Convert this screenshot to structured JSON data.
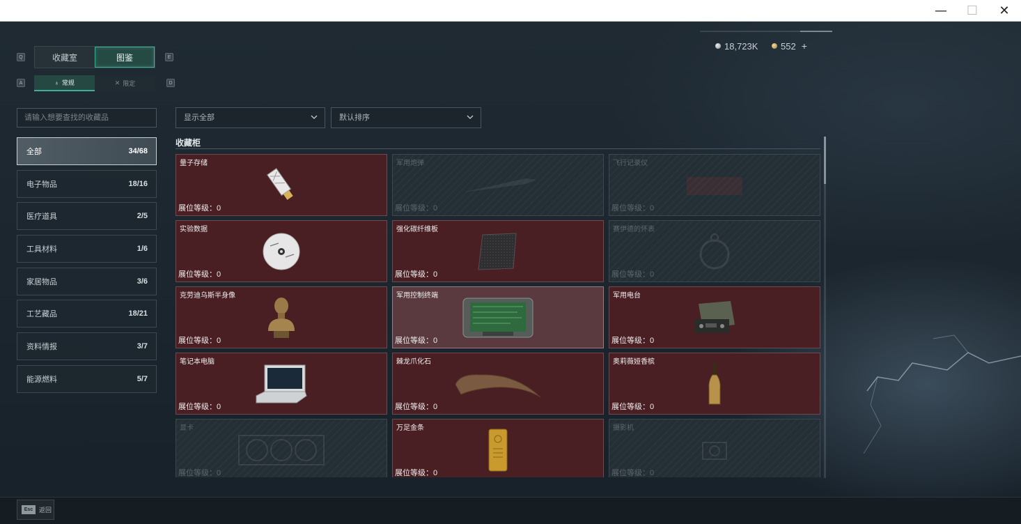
{
  "window": {
    "minimize_icon": "minimize-icon",
    "maximize_icon": "maximize-icon",
    "close_icon": "close-icon",
    "min_glyph": "—",
    "max_glyph": "☐",
    "close_glyph": "✕"
  },
  "currency": {
    "silver": "18,723K",
    "gold": "552",
    "plus": "+"
  },
  "tabs": {
    "left_key": "Q",
    "right_key": "E",
    "items": [
      {
        "label": "收藏室",
        "active": false
      },
      {
        "label": "图鉴",
        "active": true
      }
    ]
  },
  "subtabs": {
    "left_key": "A",
    "right_key": "D",
    "items": [
      {
        "label": "常规",
        "icon": "hourglass-icon",
        "glyph": "♁",
        "active": true
      },
      {
        "label": "限定",
        "icon": "crossed-swords-icon",
        "glyph": "✕",
        "active": false
      }
    ]
  },
  "search": {
    "placeholder": "请输入想要查找的收藏品"
  },
  "categories": [
    {
      "label": "全部",
      "count": "34/68",
      "active": true
    },
    {
      "label": "电子物品",
      "count": "18/16",
      "active": false
    },
    {
      "label": "医疗道具",
      "count": "2/5",
      "active": false
    },
    {
      "label": "工具材料",
      "count": "1/6",
      "active": false
    },
    {
      "label": "家居物品",
      "count": "3/6",
      "active": false
    },
    {
      "label": "工艺藏品",
      "count": "18/21",
      "active": false
    },
    {
      "label": "资料情报",
      "count": "3/7",
      "active": false
    },
    {
      "label": "能源燃料",
      "count": "5/7",
      "active": false
    }
  ],
  "filters": {
    "show": "显示全部",
    "sort": "默认排序"
  },
  "section": {
    "title": "收藏柜"
  },
  "cards": [
    {
      "name": "量子存储",
      "level": "展位等级：0",
      "state": "owned",
      "icon": "usb-drive-icon"
    },
    {
      "name": "军用炮弹",
      "level": "展位等级：0",
      "state": "locked",
      "icon": "artillery-shell-icon"
    },
    {
      "name": "飞行记录仪",
      "level": "展位等级：0",
      "state": "locked",
      "icon": "flight-recorder-icon"
    },
    {
      "name": "实验数据",
      "level": "展位等级：0",
      "state": "owned",
      "icon": "disc-icon"
    },
    {
      "name": "强化碳纤维板",
      "level": "展位等级：0",
      "state": "owned",
      "icon": "carbon-plate-icon"
    },
    {
      "name": "赛伊德的怀表",
      "level": "展位等级：0",
      "state": "locked",
      "icon": "pocket-watch-icon"
    },
    {
      "name": "克劳迪乌斯半身像",
      "level": "展位等级：0",
      "state": "owned",
      "icon": "bust-icon"
    },
    {
      "name": "军用控制终端",
      "level": "展位等级：0",
      "state": "highlight",
      "icon": "control-terminal-icon"
    },
    {
      "name": "军用电台",
      "level": "展位等级：0",
      "state": "owned",
      "icon": "radio-icon"
    },
    {
      "name": "笔记本电脑",
      "level": "展位等级：0",
      "state": "owned",
      "icon": "laptop-icon"
    },
    {
      "name": "棘龙爪化石",
      "level": "展位等级：0",
      "state": "owned",
      "icon": "claw-fossil-icon"
    },
    {
      "name": "奥莉薇娅香槟",
      "level": "展位等级：0",
      "state": "owned",
      "icon": "champagne-icon"
    },
    {
      "name": "显卡",
      "level": "展位等级：0",
      "state": "locked",
      "icon": "graphics-card-icon"
    },
    {
      "name": "万足金条",
      "level": "展位等级：0",
      "state": "owned",
      "icon": "gold-bar-icon"
    },
    {
      "name": "摄影机",
      "level": "展位等级：0",
      "state": "locked",
      "icon": "camera-icon"
    }
  ],
  "bottom": {
    "esc_key": "Esc",
    "back_label": "返回"
  }
}
